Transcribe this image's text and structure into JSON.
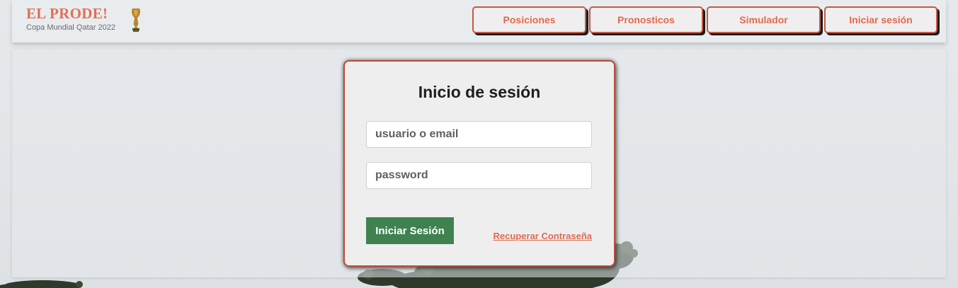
{
  "brand": {
    "title": "EL PRODE!",
    "subtitle": "Copa Mundial Qatar 2022",
    "icon": "trophy-icon"
  },
  "nav": {
    "items": [
      {
        "label": "Posiciones"
      },
      {
        "label": "Pronosticos"
      },
      {
        "label": "Simulador"
      },
      {
        "label": "Iniciar sesión"
      }
    ]
  },
  "login": {
    "title": "Inicio de sesión",
    "user_placeholder": "usuario o email",
    "user_value": "",
    "password_placeholder": "password",
    "password_value": "",
    "submit_label": "Iniciar Sesión",
    "recover_label": "Recuperar Contraseña"
  },
  "colors": {
    "accent": "#e06a50",
    "border": "#b84f3b",
    "button": "#3f8250",
    "background": "#e3e6e9"
  }
}
